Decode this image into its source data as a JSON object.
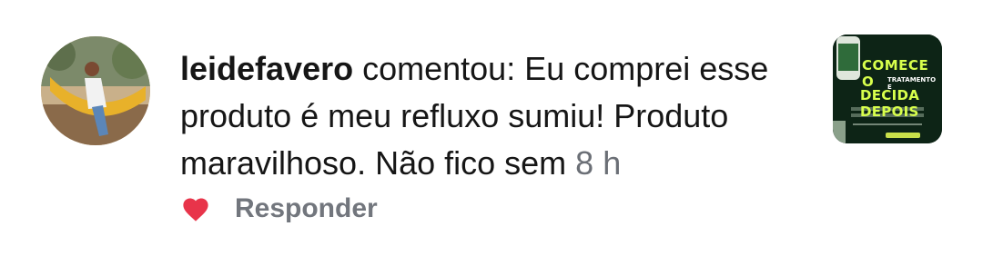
{
  "comment": {
    "username": "leidefavero",
    "text": " comentou: Eu comprei esse produto é meu refluxo sumiu! Produto maravilhoso. Não fico sem ",
    "time": "8 h"
  },
  "actions": {
    "reply_label": "Responder",
    "like_icon": "heart-icon",
    "like_color": "#e8344a"
  },
  "thumbnail": {
    "line1": "COMECE O",
    "line2": "TRATAMENTO E",
    "line3": "DECIDA DEPOIS"
  }
}
